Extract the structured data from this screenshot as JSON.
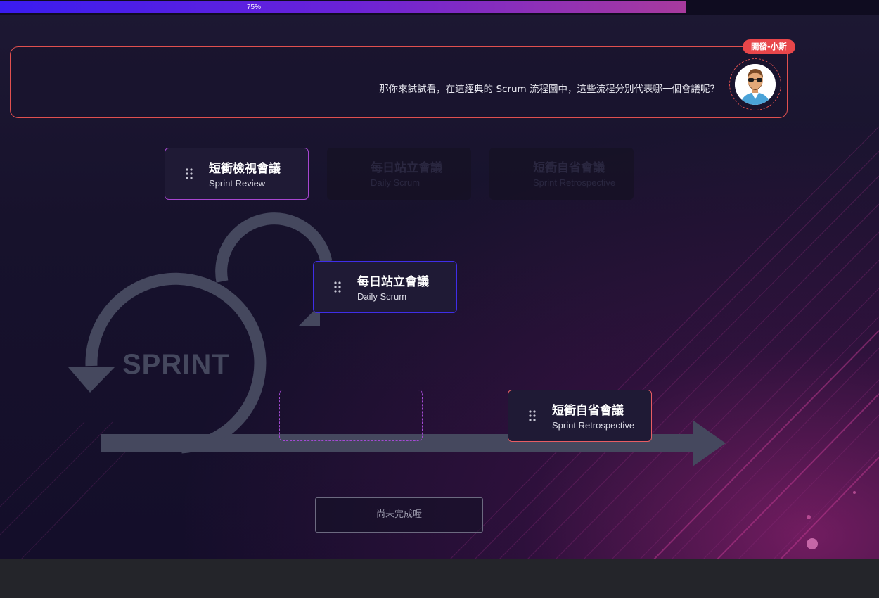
{
  "progress": {
    "value": 0.78,
    "label": "75%"
  },
  "dialog": {
    "speaker": "開發-小斯",
    "message": "那你來試試看，在這經典的 Scrum 流程圖中，這些流程分別代表哪一個會議呢？"
  },
  "cards": [
    {
      "zh": "短衝檢視會議",
      "en": "Sprint Review",
      "state": "placed",
      "border": "#a746d0"
    },
    {
      "zh": "每日站立會議",
      "en": "Daily Scrum",
      "state": "placed",
      "border": "#3f2ee8"
    },
    {
      "zh": "短衝自省會議",
      "en": "Sprint Retrospective",
      "state": "placed",
      "border": "#e85d63"
    }
  ],
  "palette": [
    {
      "zh": "每日站立會議",
      "en": "Daily Scrum"
    },
    {
      "zh": "短衝自省會議",
      "en": "Sprint Retrospective"
    }
  ],
  "diagram": {
    "label": "SPRINT"
  },
  "submit": {
    "label": "尚未完成喔"
  },
  "colors": {
    "accent": "#e8464a",
    "diagram": "#45485e"
  }
}
